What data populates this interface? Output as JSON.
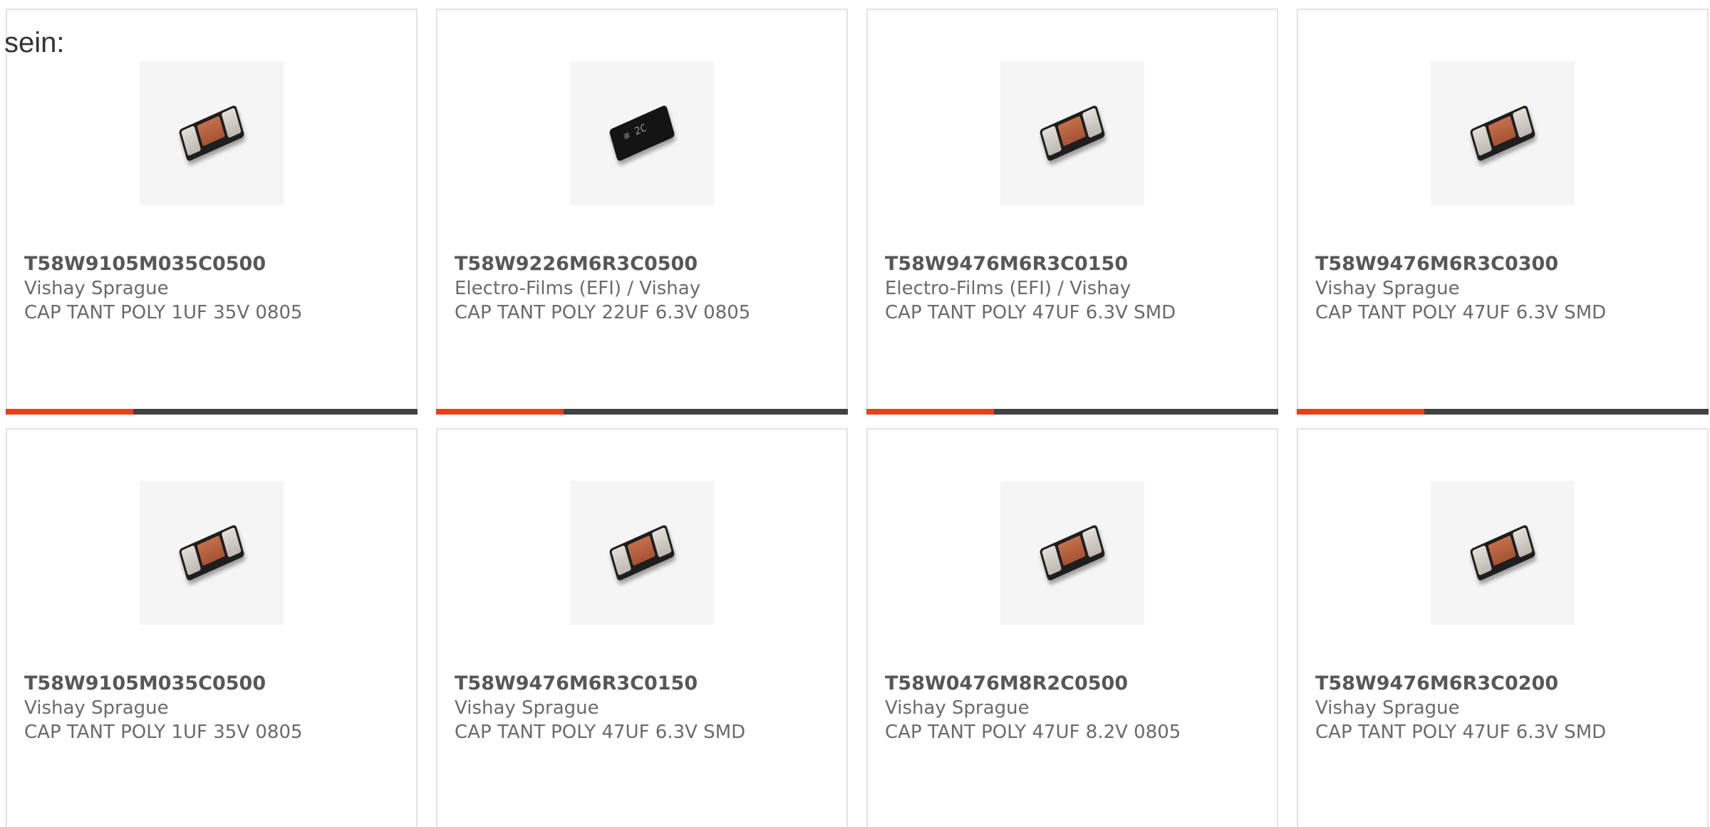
{
  "intro": {
    "text": "sein:"
  },
  "colors": {
    "accent": "#e8401c",
    "bar_track": "#424242",
    "card_border": "#e3e3e3"
  },
  "products": [
    {
      "part_number": "T58W9105M035C0500",
      "manufacturer": "Vishay Sprague",
      "description": "CAP TANT POLY 1UF 35V 0805",
      "image_icon": "tantalum-chip-icon",
      "progress": 0.31
    },
    {
      "part_number": "T58W9226M6R3C0500",
      "manufacturer": "Electro-Films (EFI) / Vishay",
      "description": "CAP TANT POLY 22UF 6.3V 0805",
      "image_icon": "tantalum-chip-icon",
      "progress": 0.31
    },
    {
      "part_number": "T58W9476M6R3C0150",
      "manufacturer": "Electro-Films (EFI) / Vishay",
      "description": "CAP TANT POLY 47UF 6.3V SMD",
      "image_icon": "tantalum-chip-icon",
      "progress": 0.31
    },
    {
      "part_number": "T58W9476M6R3C0300",
      "manufacturer": "Vishay Sprague",
      "description": "CAP TANT POLY 47UF 6.3V SMD",
      "image_icon": "tantalum-chip-icon",
      "progress": 0.31
    },
    {
      "part_number": "T58W9105M035C0500",
      "manufacturer": "Vishay Sprague",
      "description": "CAP TANT POLY 1UF 35V 0805",
      "image_icon": "tantalum-chip-icon"
    },
    {
      "part_number": "T58W9476M6R3C0150",
      "manufacturer": "Vishay Sprague",
      "description": "CAP TANT POLY 47UF 6.3V SMD",
      "image_icon": "tantalum-chip-icon"
    },
    {
      "part_number": "T58W0476M8R2C0500",
      "manufacturer": "Vishay Sprague",
      "description": "CAP TANT POLY 47UF 8.2V 0805",
      "image_icon": "tantalum-chip-icon"
    },
    {
      "part_number": "T58W9476M6R3C0200",
      "manufacturer": "Vishay Sprague",
      "description": "CAP TANT POLY 47UF 6.3V SMD",
      "image_icon": "tantalum-chip-icon"
    }
  ]
}
